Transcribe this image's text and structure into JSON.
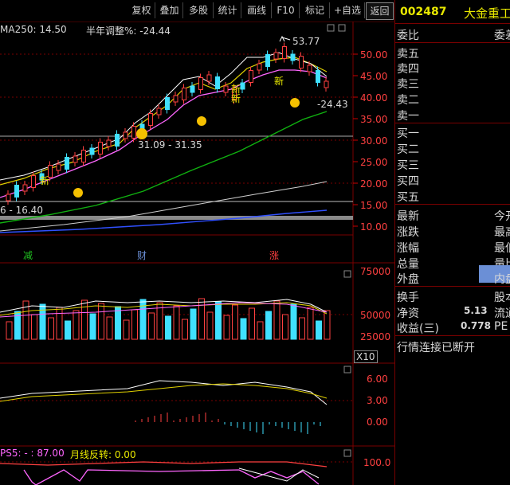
{
  "toolbar": {
    "buttons": [
      "复权",
      "叠加",
      "多股",
      "统计",
      "画线",
      "F10",
      "标记",
      "+自选",
      "返回"
    ]
  },
  "chart": {
    "ma_label": "MA250: 14.50",
    "adjust_label": "半年调整%: -24.44",
    "high_label": "53.77",
    "right_label": "-24.43",
    "range_label": "31.09 - 31.35",
    "low_label": "6 - 16.40",
    "price_ticks": [
      "50.00",
      "45.00",
      "40.00",
      "35.00",
      "30.00",
      "25.00",
      "20.00",
      "15.00",
      "10.00"
    ],
    "events": [
      "减",
      "财",
      "涨"
    ],
    "new_marks": [
      "新",
      "新",
      "新",
      "新"
    ],
    "volume_ticks": [
      "75000",
      "50000",
      "25000"
    ],
    "volume_unit": "X10",
    "macd_ticks": [
      "6.00",
      "3.00",
      "0.00"
    ],
    "bottom_label": "PS5: - : 87.00",
    "bottom_label2": "月线反转: 0.00",
    "bottom_tick": "100.0"
  },
  "side": {
    "code": "002487",
    "name": "大金重工",
    "weibi": "委比",
    "weicha": "委差",
    "sell": [
      "卖五",
      "卖四",
      "卖三",
      "卖二",
      "卖一"
    ],
    "buy": [
      "买一",
      "买二",
      "买三",
      "买四",
      "买五"
    ],
    "stats_left": [
      "最新",
      "涨跌",
      "涨幅",
      "总量",
      "外盘"
    ],
    "stats_right": [
      "今开",
      "最高",
      "最低",
      "量比",
      "内盘"
    ],
    "huanshou": "换手",
    "guben": "股本",
    "jingzi": "净资",
    "jingzi_val": "5.13",
    "liutong": "流通",
    "shouyi": "收益(三)",
    "shouyi_val": "0.778",
    "pe": "PE",
    "status": "行情连接已断开"
  }
}
